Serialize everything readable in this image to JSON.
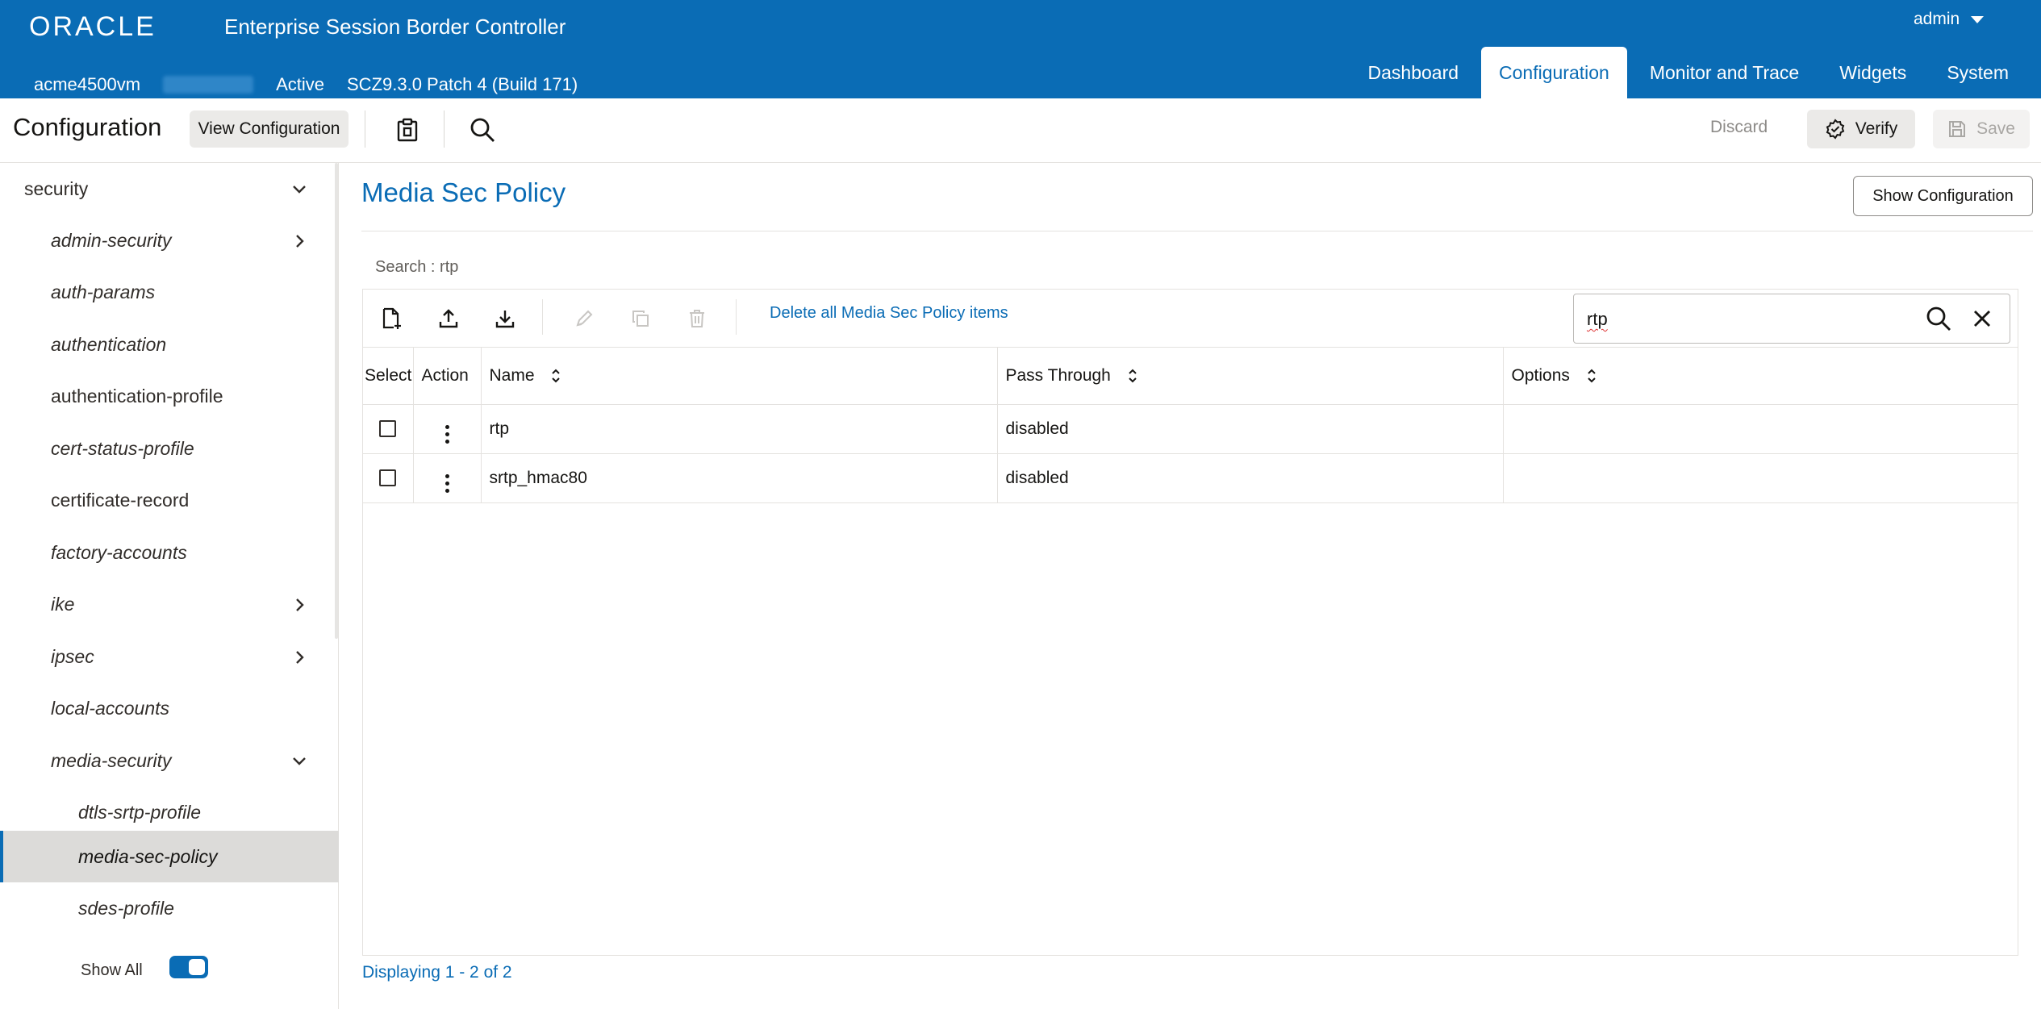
{
  "header": {
    "brand": "ORACLE",
    "product": "Enterprise Session Border Controller",
    "user": "admin",
    "hostname": "acme4500vm",
    "status": "Active",
    "version": "SCZ9.3.0 Patch 4 (Build 171)",
    "nav": [
      {
        "label": "Dashboard",
        "active": false
      },
      {
        "label": "Configuration",
        "active": true
      },
      {
        "label": "Monitor and Trace",
        "active": false
      },
      {
        "label": "Widgets",
        "active": false
      },
      {
        "label": "System",
        "active": false
      }
    ]
  },
  "toolbar": {
    "title": "Configuration",
    "view_configuration": "View Configuration",
    "discard": "Discard",
    "verify": "Verify",
    "save": "Save"
  },
  "sidebar": {
    "items": [
      {
        "label": "security",
        "italic": false,
        "chevron": "down",
        "level": 0
      },
      {
        "label": "admin-security",
        "italic": true,
        "chevron": "right",
        "level": 1
      },
      {
        "label": "auth-params",
        "italic": true,
        "chevron": null,
        "level": 1
      },
      {
        "label": "authentication",
        "italic": true,
        "chevron": null,
        "level": 1
      },
      {
        "label": "authentication-profile",
        "italic": false,
        "chevron": null,
        "level": 1
      },
      {
        "label": "cert-status-profile",
        "italic": true,
        "chevron": null,
        "level": 1
      },
      {
        "label": "certificate-record",
        "italic": false,
        "chevron": null,
        "level": 1
      },
      {
        "label": "factory-accounts",
        "italic": true,
        "chevron": null,
        "level": 1
      },
      {
        "label": "ike",
        "italic": true,
        "chevron": "right",
        "level": 1
      },
      {
        "label": "ipsec",
        "italic": true,
        "chevron": "right",
        "level": 1
      },
      {
        "label": "local-accounts",
        "italic": true,
        "chevron": null,
        "level": 1
      },
      {
        "label": "media-security",
        "italic": true,
        "chevron": "down",
        "level": 1
      },
      {
        "label": "dtls-srtp-profile",
        "italic": true,
        "chevron": null,
        "level": 2
      },
      {
        "label": "media-sec-policy",
        "italic": true,
        "chevron": null,
        "level": 2,
        "selected": true
      },
      {
        "label": "sdes-profile",
        "italic": true,
        "chevron": null,
        "level": 2
      }
    ],
    "show_all": "Show All",
    "show_all_on": true
  },
  "main": {
    "title": "Media Sec Policy",
    "show_configuration": "Show Configuration",
    "search_crumb": "Search : rtp",
    "delete_all": "Delete all Media Sec Policy items",
    "search_value": "rtp",
    "columns": [
      "Select",
      "Action",
      "Name",
      "Pass Through",
      "Options"
    ],
    "rows": [
      {
        "name": "rtp",
        "pass_through": "disabled",
        "options": ""
      },
      {
        "name": "srtp_hmac80",
        "pass_through": "disabled",
        "options": ""
      }
    ],
    "pager": "Displaying 1 - 2 of 2"
  },
  "colors": {
    "brand_blue": "#0a6cb5",
    "selected_row": "#dcdbd9"
  }
}
